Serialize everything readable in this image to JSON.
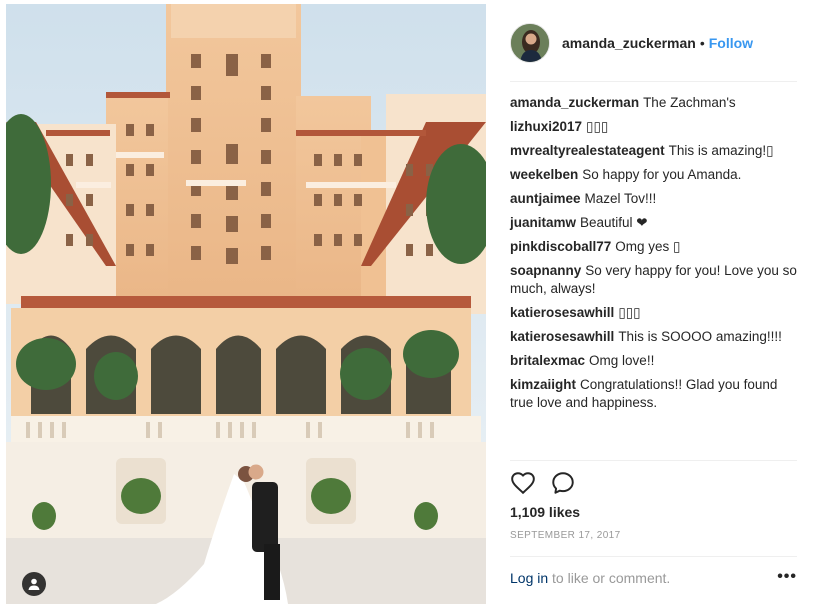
{
  "post": {
    "username": "amanda_zuckerman",
    "separator": "•",
    "follow_label": "Follow",
    "likes": "1,109 likes",
    "date": "SEPTEMBER 17, 2017",
    "login_link": "Log in",
    "login_suffix": " to like or comment.",
    "more_label": "•••"
  },
  "comments": [
    {
      "user": "amanda_zuckerman",
      "text": "The Zachman's"
    },
    {
      "user": "lizhuxi2017",
      "text": "▯▯▯"
    },
    {
      "user": "mvrealtyrealestateagent",
      "text": "This is amazing!▯"
    },
    {
      "user": "weekelben",
      "text": "So happy for you Amanda."
    },
    {
      "user": "auntjaimee",
      "text": "Mazel Tov!!!"
    },
    {
      "user": "juanitamw",
      "text": "Beautiful ❤"
    },
    {
      "user": "pinkdiscoball77",
      "text": "Omg yes ▯"
    },
    {
      "user": "soapnanny",
      "text": "So very happy for you! Love you so much, always!"
    },
    {
      "user": "katierosesawhill",
      "text": "▯▯▯"
    },
    {
      "user": "katierosesawhill",
      "text": "This is SOOOO amazing!!!!"
    },
    {
      "user": "britalexmac",
      "text": "Omg love!!"
    },
    {
      "user": "kimzaiight",
      "text": "Congratulations!! Glad you found true love and happiness."
    }
  ],
  "icons": {
    "like": "heart-icon",
    "comment": "comment-icon",
    "tag": "user-tag-icon"
  },
  "colors": {
    "link": "#3897f0",
    "text": "#262626",
    "muted": "#999999"
  }
}
